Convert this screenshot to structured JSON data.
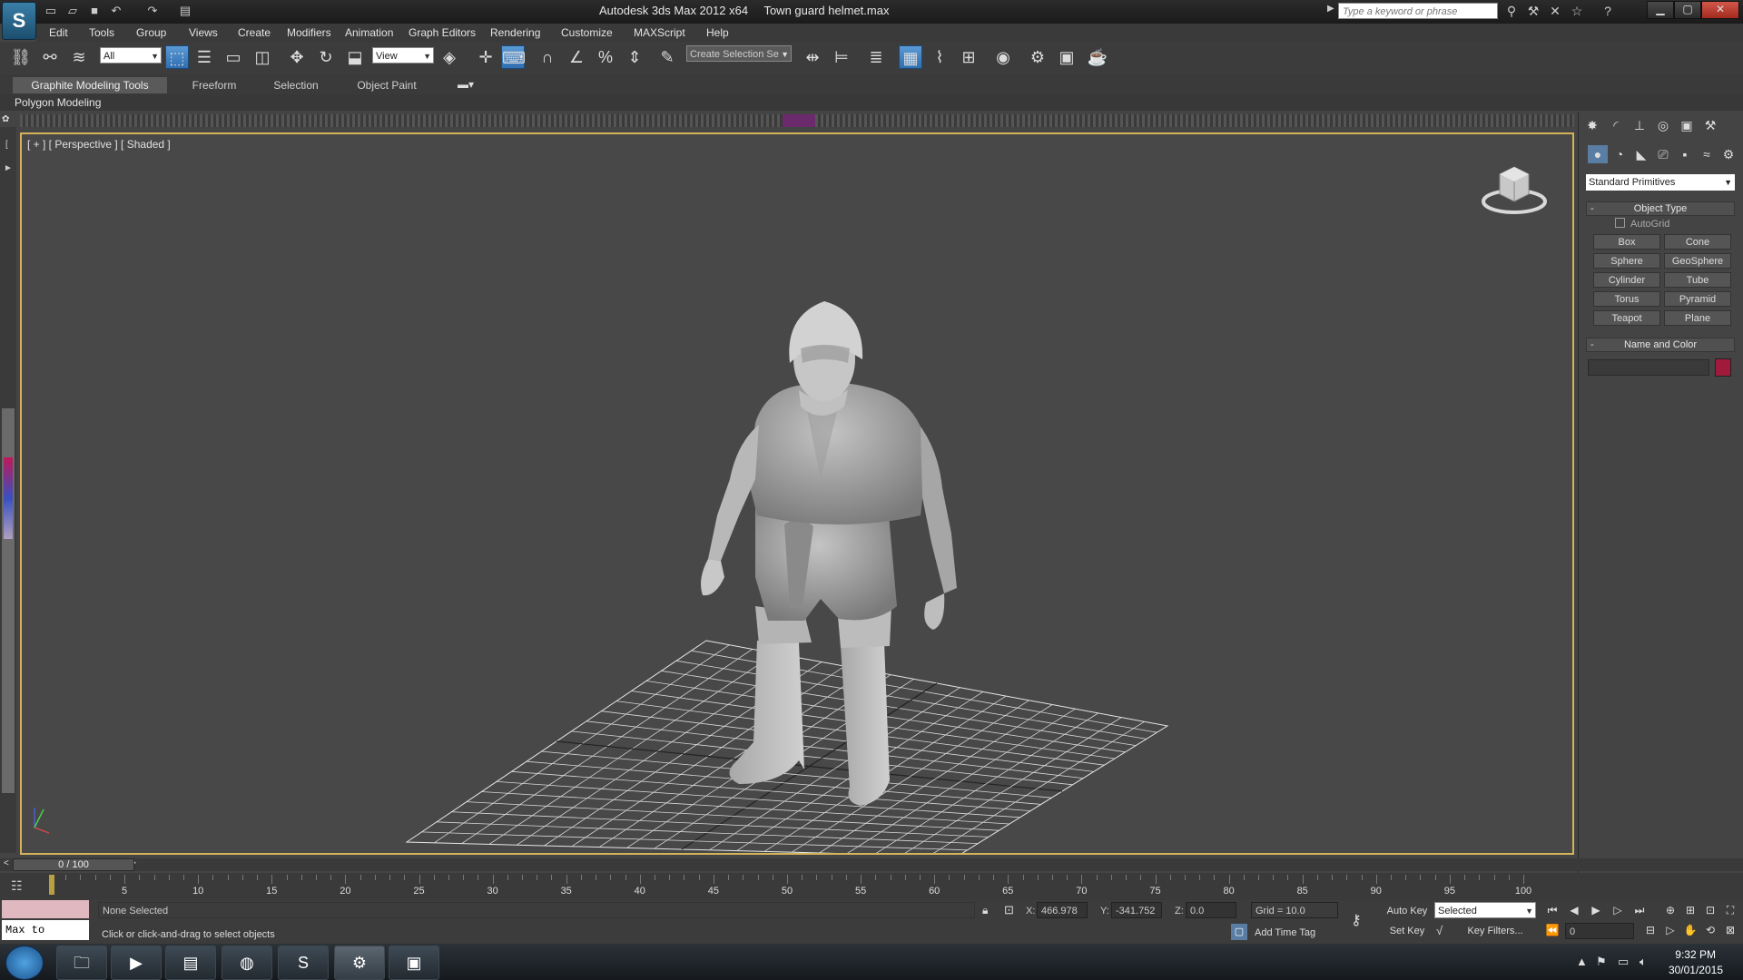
{
  "titlebar": {
    "app_title": "Autodesk 3ds Max 2012 x64",
    "file_name": "Town guard helmet.max",
    "search_placeholder": "Type a keyword or phrase",
    "min_glyph": "▁",
    "max_glyph": "▢",
    "close_glyph": "✕"
  },
  "menu": [
    "Edit",
    "Tools",
    "Group",
    "Views",
    "Create",
    "Modifiers",
    "Animation",
    "Graph Editors",
    "Rendering",
    "Customize",
    "MAXScript",
    "Help"
  ],
  "toolbar": {
    "selection_filter": "All",
    "reference_coord": "View",
    "named_selection": "Create Selection Se"
  },
  "ribbon": {
    "tabs": [
      "Graphite Modeling Tools",
      "Freeform",
      "Selection",
      "Object Paint"
    ],
    "sub_label": "Polygon Modeling"
  },
  "viewport": {
    "label": "[ + ] [ Perspective ] [ Shaded ]"
  },
  "command_panel": {
    "category": "Standard Primitives",
    "object_type_title": "Object Type",
    "autogrid": "AutoGrid",
    "primitives": [
      "Box",
      "Cone",
      "Sphere",
      "GeoSphere",
      "Cylinder",
      "Tube",
      "Torus",
      "Pyramid",
      "Teapot",
      "Plane"
    ],
    "name_color_title": "Name and Color",
    "object_color": "#a01a3c",
    "rollout_toggle": "-"
  },
  "timeline": {
    "position": "0 / 100",
    "ticks": [
      5,
      10,
      15,
      20,
      25,
      30,
      35,
      40,
      45,
      50,
      55,
      60,
      65,
      70,
      75,
      80,
      85,
      90,
      95,
      100
    ]
  },
  "status": {
    "maxscript_text": "Max to Physc.",
    "selection_status": "None Selected",
    "prompt": "Click or click-and-drag to select objects",
    "x_label": "X:",
    "x_value": "466.978",
    "y_label": "Y:",
    "y_value": "-341.752",
    "z_label": "Z:",
    "z_value": "0.0",
    "grid": "Grid = 10.0",
    "add_time_tag": "Add Time Tag",
    "auto_key": "Auto Key",
    "set_key": "Set Key",
    "key_mode": "Selected",
    "key_filters": "Key Filters...",
    "frame": "0"
  },
  "taskbar": {
    "time": "9:32 PM",
    "date": "30/01/2015"
  }
}
